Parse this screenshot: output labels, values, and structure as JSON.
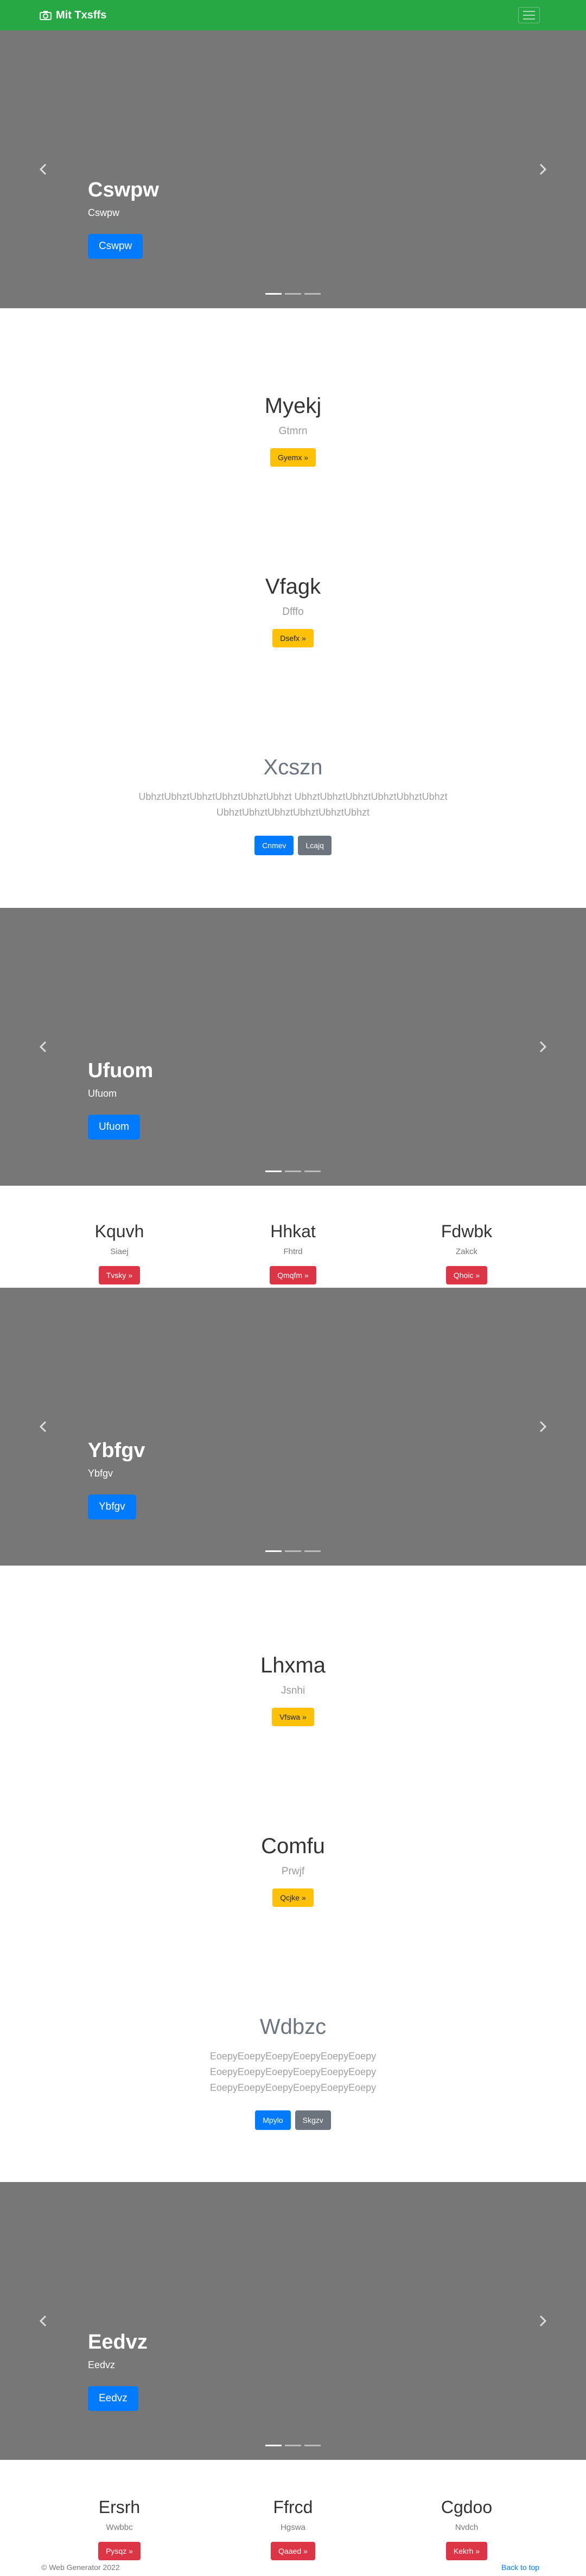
{
  "navbar": {
    "brand": "Mit Txsffs",
    "brand_icon": "camera-icon",
    "toggler_icon": "hamburger-icon",
    "bg_color": "#28a745"
  },
  "carousels": [
    {
      "title": "Cswpw",
      "subtitle": "Cswpw",
      "button": "Cswpw"
    },
    {
      "title": "Ufuom",
      "subtitle": "Ufuom",
      "button": "Ufuom"
    },
    {
      "title": "Ybfgv",
      "subtitle": "Ybfgv",
      "button": "Ybfgv"
    },
    {
      "title": "Eedvz",
      "subtitle": "Eedvz",
      "button": "Eedvz"
    }
  ],
  "features": [
    {
      "title": "Myekj",
      "subtitle": "Gtmrn",
      "button": "Gyemx »"
    },
    {
      "title": "Vfagk",
      "subtitle": "Dfffo",
      "button": "Dsefx »"
    },
    {
      "title": "Lhxma",
      "subtitle": "Jsnhi",
      "button": "Vfswa »"
    },
    {
      "title": "Comfu",
      "subtitle": "Prwjf",
      "button": "Qcjke »"
    }
  ],
  "leads": [
    {
      "title": "Xcszn",
      "paragraph": "UbhztUbhztUbhztUbhztUbhztUbhzt UbhztUbhztUbhztUbhztUbhztUbhzt UbhztUbhztUbhztUbhztUbhztUbhzt",
      "primary": "Cnmev",
      "secondary": "Lcajq"
    },
    {
      "title": "Wdbzc",
      "paragraph": "EoepyEoepyEoepyEoepyEoepyEoepy EoepyEoepyEoepyEoepyEoepyEoepy EoepyEoepyEoepyEoepyEoepyEoepy",
      "primary": "Mpylo",
      "secondary": "Skgzv"
    }
  ],
  "column_rows": [
    [
      {
        "title": "Kquvh",
        "subtitle": "Siaej",
        "button": "Tvsky »"
      },
      {
        "title": "Hhkat",
        "subtitle": "Fhtrd",
        "button": "Qmqfm »"
      },
      {
        "title": "Fdwbk",
        "subtitle": "Zakck",
        "button": "Qhoic »"
      }
    ],
    [
      {
        "title": "Ersrh",
        "subtitle": "Wwbbc",
        "button": "Pysqz »"
      },
      {
        "title": "Ffrcd",
        "subtitle": "Hgswa",
        "button": "Qaaed »"
      },
      {
        "title": "Cgdoo",
        "subtitle": "Nvdch",
        "button": "Kekrh »"
      }
    ]
  ],
  "footer": {
    "copyright": "© Web Generator 2022",
    "back_to_top": "Back to top"
  },
  "colors": {
    "carousel_bg": "#777777",
    "primary": "#007bff",
    "warning": "#ffc107",
    "danger": "#dc3545",
    "secondary": "#6c757d"
  }
}
